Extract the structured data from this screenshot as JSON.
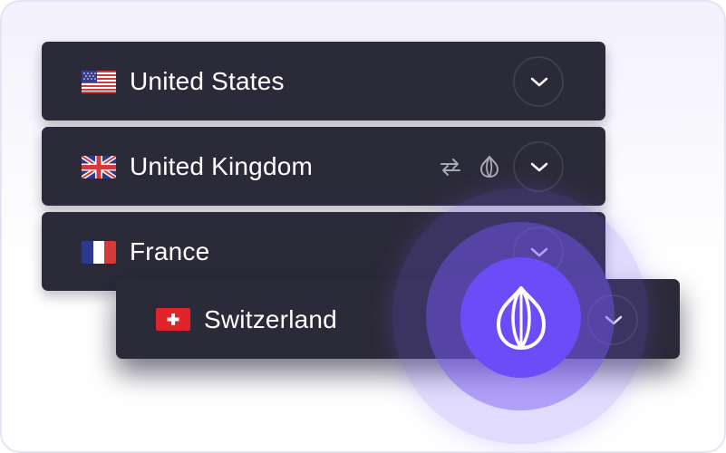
{
  "servers": [
    {
      "name": "United States",
      "flag": "us-flag"
    },
    {
      "name": "United Kingdom",
      "flag": "uk-flag",
      "icons": [
        "swap-icon",
        "onion-icon"
      ]
    },
    {
      "name": "France",
      "flag": "fr-flag"
    },
    {
      "name": "Switzerland",
      "flag": "ch-flag"
    }
  ],
  "colors": {
    "row_bg": "#2b2a38",
    "accent": "#6c4cf7",
    "text": "#ffffff"
  }
}
